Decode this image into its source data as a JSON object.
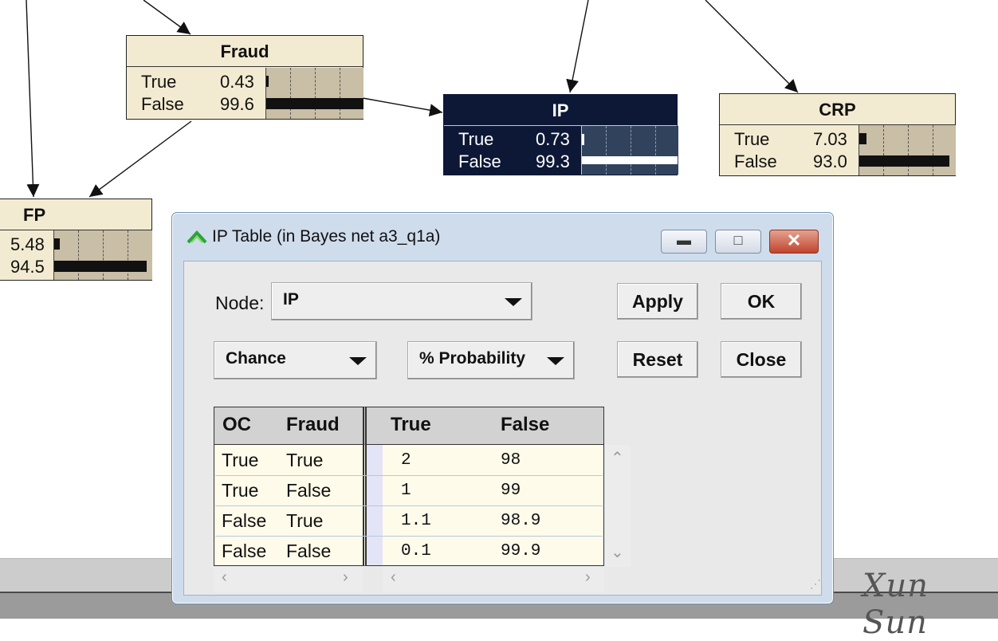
{
  "network": {
    "nodes": {
      "fraud": {
        "title": "Fraud",
        "states": [
          {
            "label": "True",
            "value": "0.43",
            "fraction": 0.0043
          },
          {
            "label": "False",
            "value": "99.6",
            "fraction": 0.996
          }
        ]
      },
      "ip": {
        "title": "IP",
        "states": [
          {
            "label": "True",
            "value": "0.73",
            "fraction": 0.0073
          },
          {
            "label": "False",
            "value": "99.3",
            "fraction": 0.993
          }
        ]
      },
      "crp": {
        "title": "CRP",
        "states": [
          {
            "label": "True",
            "value": "7.03",
            "fraction": 0.0703
          },
          {
            "label": "False",
            "value": "93.0",
            "fraction": 0.93
          }
        ]
      },
      "fp": {
        "title": "FP",
        "states": [
          {
            "value": "5.48",
            "fraction": 0.0548
          },
          {
            "value": "94.5",
            "fraction": 0.945
          }
        ]
      }
    }
  },
  "dialog": {
    "title": "IP Table (in Bayes net a3_q1a)",
    "node_label": "Node:",
    "node_value": "IP",
    "node_kind": "Chance",
    "display_mode": "% Probability",
    "buttons": {
      "apply": "Apply",
      "ok": "OK",
      "reset": "Reset",
      "close": "Close"
    },
    "window_controls": {
      "minimize": "minimize-icon",
      "maximize": "maximize-icon",
      "close": "close-icon"
    },
    "table": {
      "parent_headers": [
        "OC",
        "Fraud"
      ],
      "state_headers": [
        "True",
        "False"
      ],
      "rows": [
        {
          "oc": "True",
          "fraud": "True",
          "p_true": "2",
          "p_false": "98"
        },
        {
          "oc": "True",
          "fraud": "False",
          "p_true": "1",
          "p_false": "99"
        },
        {
          "oc": "False",
          "fraud": "True",
          "p_true": "1.1",
          "p_false": "98.9"
        },
        {
          "oc": "False",
          "fraud": "False",
          "p_true": "0.1",
          "p_false": "99.9"
        }
      ]
    }
  },
  "watermark": "Xun Sun",
  "colors": {
    "node_bg": "#f3ebd1",
    "selected_node_bg": "#0d1836",
    "dialog_frame": "#cfdcec",
    "table_row_bg": "#fffbea"
  }
}
